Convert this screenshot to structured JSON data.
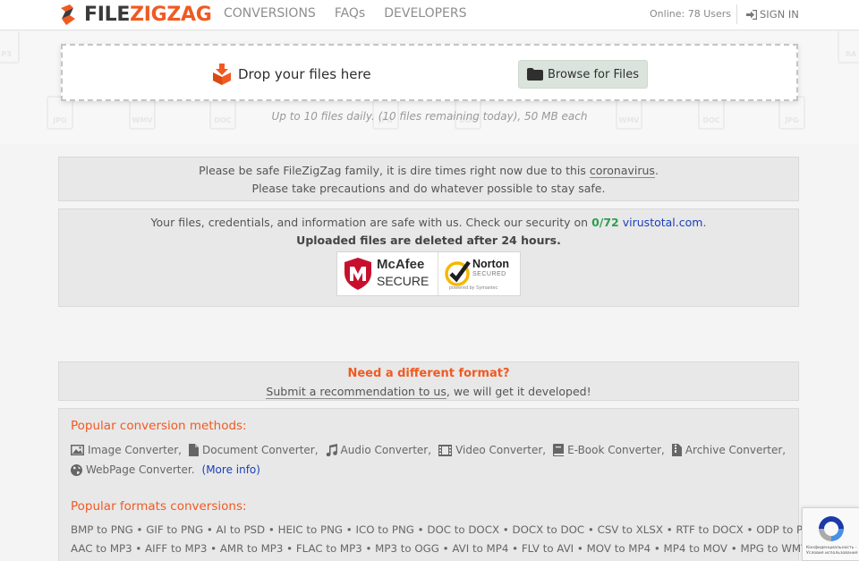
{
  "header": {
    "logo_part1": "FILE",
    "logo_part2": "ZIGZAG",
    "nav": [
      "CONVERSIONS",
      "FAQs",
      "DEVELOPERS"
    ],
    "online_text": "Online: 78 Users",
    "signin_label": "SIGN IN"
  },
  "background_formats": [
    "P3",
    "JPG",
    "WMV",
    "DOC",
    "JPG",
    "DOC",
    "WMV",
    "DOC",
    "JPG",
    "RA"
  ],
  "upload": {
    "drop_text": "Drop your files here",
    "browse_label": "Browse for Files",
    "limit_text": "Up to 10 files daily. (10 files remaining today), 50 MB each"
  },
  "notice": {
    "line1_pre": "Please be safe FileZigZag family, it is dire times right now due to this ",
    "line1_link": "coronavirus",
    "line1_post": ".",
    "line2": "Please take precautions and do whatever possible to stay safe."
  },
  "security": {
    "line1_pre": "Your files, credentials, and information are safe with us. Check our security on ",
    "score": "0/72",
    "site": "virustotal.com",
    "line1_post": ".",
    "line2": "Uploaded files are deleted after 24 hours.",
    "mcafee_name": "McAfee",
    "mcafee_secure": "SECURE",
    "norton_name": "Norton",
    "norton_secured": "SECURED",
    "norton_powered": "powered by Symantec"
  },
  "different_format": {
    "title": "Need a different format?",
    "link": "Submit a recommendation to us",
    "post": ", we will get it developed!"
  },
  "popular_methods": {
    "title": "Popular conversion methods:",
    "row1": [
      "Image Converter,",
      "Document Converter,",
      "Audio Converter,",
      "Video Converter,",
      "E-Book Converter,",
      "Archive Converter,"
    ],
    "row2_item": "WebPage Converter.",
    "more_info": "(More info)"
  },
  "popular_formats": {
    "title": "Popular formats conversions:",
    "row1": "BMP to PNG • GIF to PNG • AI to PSD • HEIC to PNG • ICO to PNG • DOC to DOCX • DOCX to DOC • CSV to XLSX • RTF to DOCX • ODP to PPTX •",
    "row2": "AAC to MP3 • AIFF to MP3 • AMR to MP3 • FLAC to MP3 • MP3 to OGG • AVI to MP4 • FLV to AVI • MOV to MP4 • MP4 to MOV • MPG to WMV •"
  },
  "recaptcha": {
    "line1": "Конфиденциальность -",
    "line2": "Условия использования"
  },
  "colors": {
    "brand_orange": "#f05a22",
    "link_blue": "#1a3fb8",
    "score_green": "#2e9e4f"
  }
}
